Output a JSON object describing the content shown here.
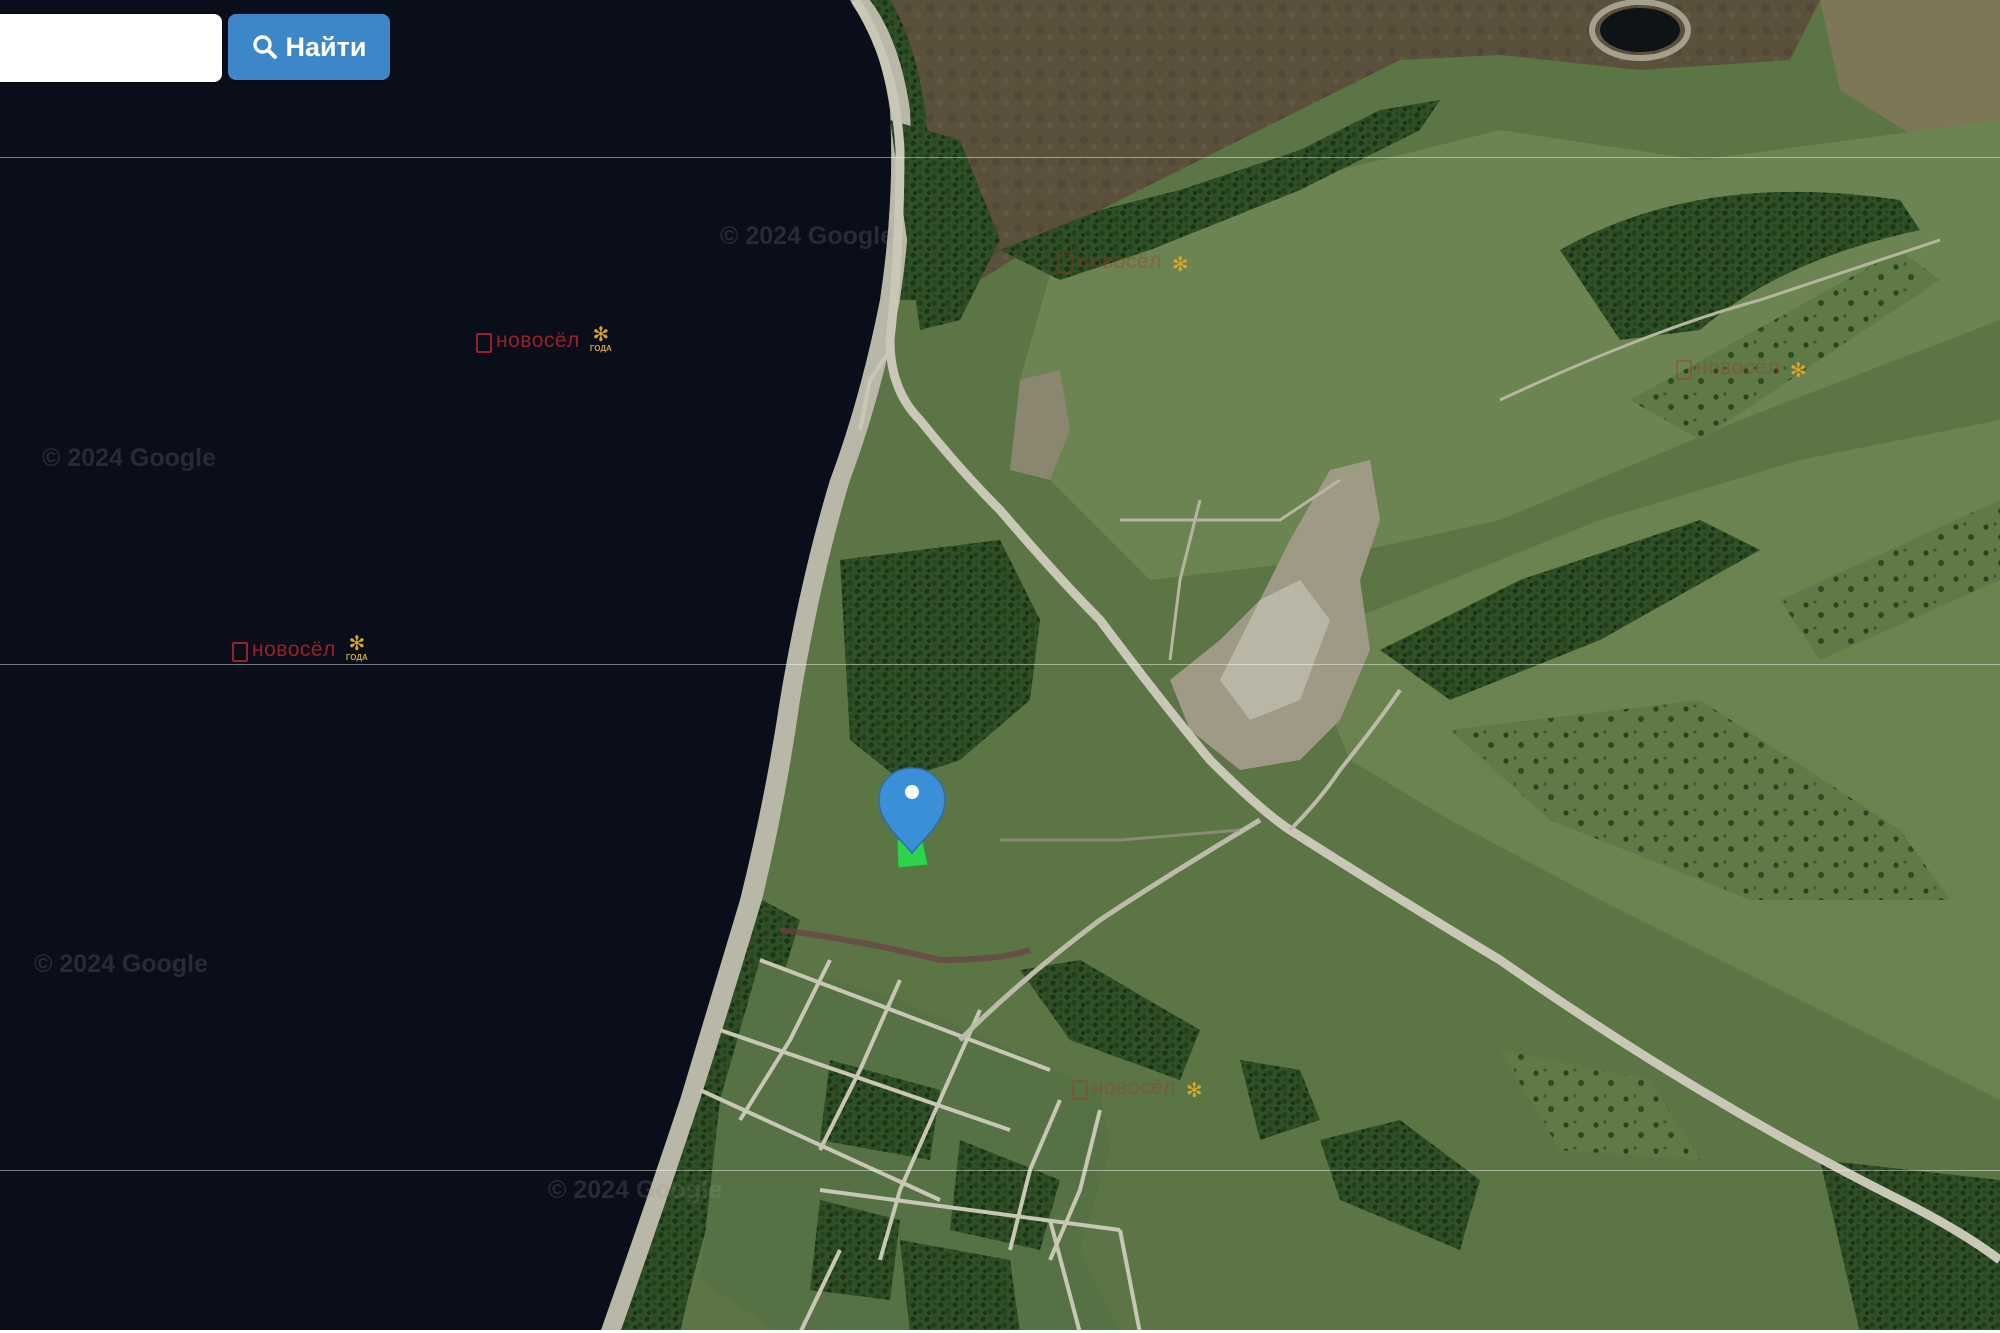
{
  "search": {
    "placeholder": "",
    "value": "",
    "button_label": "Найти",
    "button_icon": "search-icon",
    "button_color": "#3d87c9"
  },
  "map": {
    "imagery": "satellite",
    "water_color": "#0a0d1a",
    "marker": {
      "icon": "map-pin-icon",
      "color": "#3b8fd6"
    },
    "parcel": {
      "color": "#2fd24a"
    },
    "watermarks": [
      "© 2024 Google",
      "© 2024 Google",
      "© 2024 Google",
      "© 2024 Google"
    ],
    "overlay_logos": [
      {
        "text": "новосёл",
        "award": "ГОДА"
      },
      {
        "text": "новосёл",
        "award": "ГОДА"
      },
      {
        "text": "новосёл",
        "award": ""
      },
      {
        "text": "новосёл",
        "award": ""
      },
      {
        "text": "новосёл",
        "award": ""
      }
    ]
  }
}
